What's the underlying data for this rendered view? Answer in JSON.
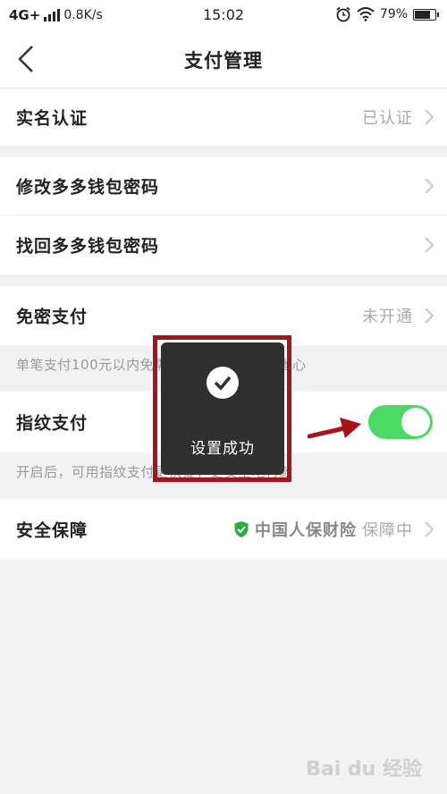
{
  "status_bar": {
    "network": "4G+",
    "speed": "0.8K/s",
    "time": "15:02",
    "battery": "79%",
    "battery_level": 0.79,
    "icons": [
      "signal-icon",
      "alarm-icon",
      "wifi-icon",
      "battery-icon"
    ]
  },
  "header": {
    "title": "支付管理",
    "back_icon": "chevron-left-icon"
  },
  "rows": {
    "realname": {
      "label": "实名认证",
      "value": "已认证"
    },
    "change_pwd": {
      "label": "修改多多钱包密码"
    },
    "find_pwd": {
      "label": "找回多多钱包密码"
    },
    "nopwd": {
      "label": "免密支付",
      "value": "未开通"
    },
    "nopwd_hint": "单笔支付100元以内免需验证密码，支付更省心",
    "fingerprint": {
      "label": "指纹支付",
      "enabled": true
    },
    "fingerprint_hint": "开启后，可用指纹支付更快捷，更安全地付款",
    "security": {
      "label": "安全保障",
      "brand": "中国人保财险",
      "status": "保障中"
    }
  },
  "toast": {
    "message": "设置成功",
    "icon": "checkmark-icon"
  },
  "annotation": {
    "highlight_color": "#a3141b",
    "arrow_icon": "arrow-right-icon"
  },
  "colors": {
    "toggle_on": "#4cd964",
    "shield": "#2eaa3f",
    "toast_bg": "#2f2f2f"
  },
  "watermark": "Bai du 经验"
}
